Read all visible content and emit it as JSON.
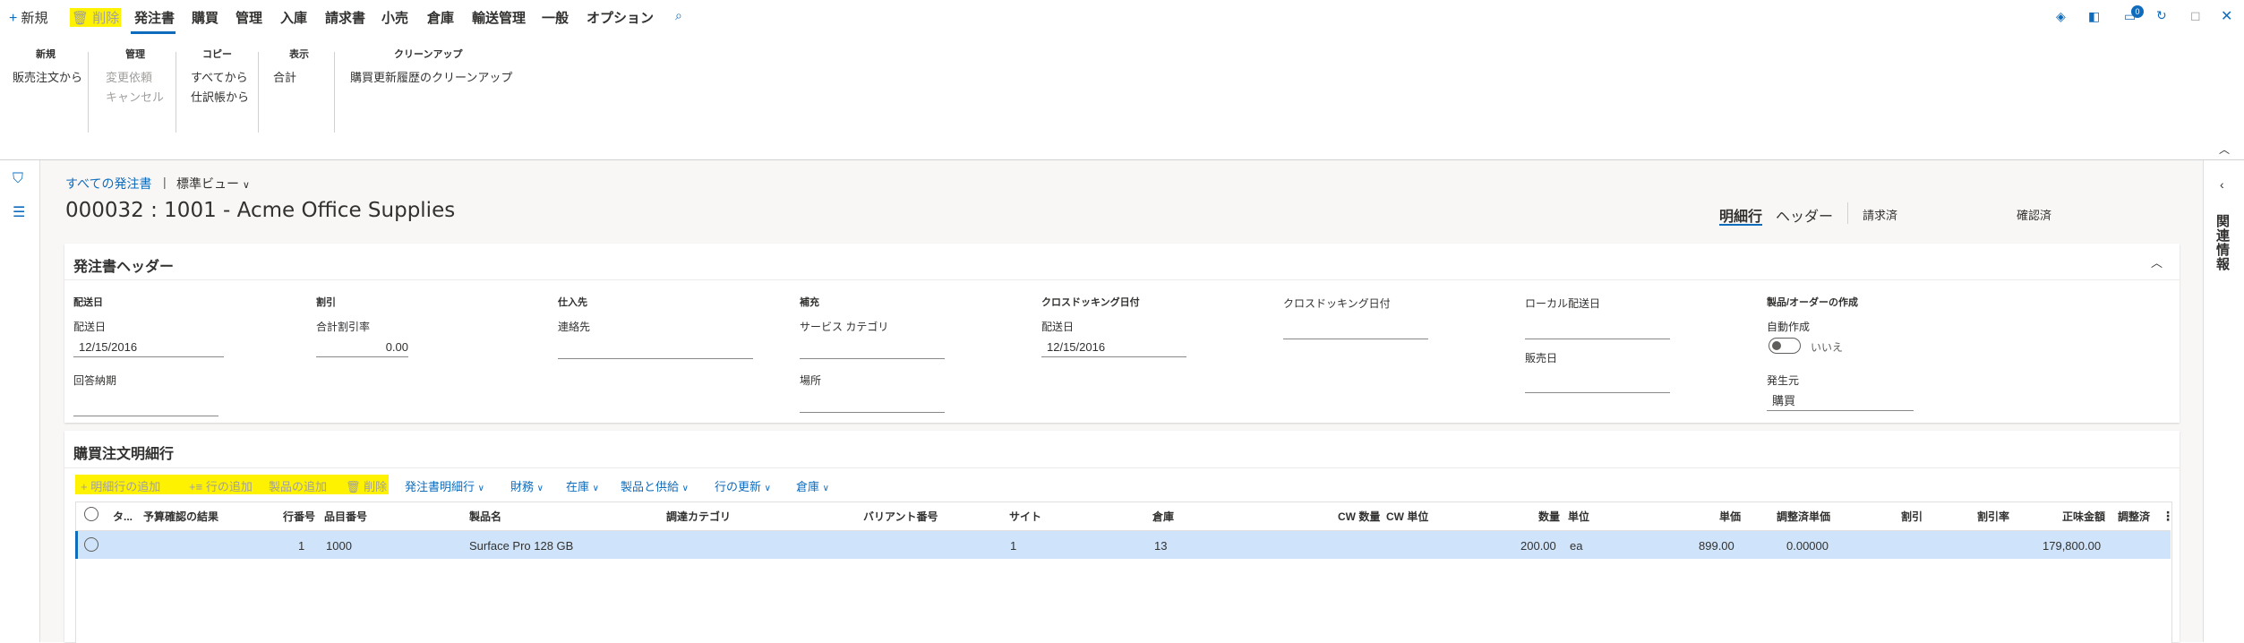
{
  "topbar": {
    "new": "新規",
    "delete": "削除",
    "tabs": [
      "発注書",
      "購買",
      "管理",
      "入庫",
      "請求書",
      "小売",
      "倉庫",
      "輸送管理",
      "一般",
      "オプション"
    ],
    "notification_count": "0"
  },
  "ribbon": {
    "groups": {
      "new": {
        "title": "新規",
        "items": [
          "販売注文から"
        ]
      },
      "manage": {
        "title": "管理",
        "items": [
          "変更依頼",
          "キャンセル"
        ]
      },
      "copy": {
        "title": "コピー",
        "items": [
          "すべてから",
          "仕訳帳から"
        ]
      },
      "view": {
        "title": "表示",
        "items": [
          "合計"
        ]
      },
      "cleanup": {
        "title": "クリーンアップ",
        "items": [
          "購買更新履歴のクリーンアップ"
        ]
      }
    }
  },
  "page": {
    "breadcrumb_link": "すべての発注書",
    "breadcrumb_sep": "|",
    "view_name": "標準ビュー",
    "title": "000032 : 1001 - Acme Office Supplies",
    "view_tabs": [
      "明細行",
      "ヘッダー"
    ],
    "status_invoice": "請求済",
    "status_confirm": "確認済",
    "related_info": "関連情報"
  },
  "header_card": {
    "title": "発注書ヘッダー",
    "sections": {
      "delivery": {
        "label": "配送日",
        "field_label": "配送日",
        "value": "12/15/2016",
        "reply_label": "回答納期"
      },
      "discount": {
        "label": "割引",
        "field_label": "合計割引率",
        "value": "0.00"
      },
      "vendor": {
        "label": "仕入先",
        "field_label": "連絡先"
      },
      "replenish": {
        "label": "補充",
        "field_label": "サービス カテゴリ",
        "site_label": "場所"
      },
      "crossdock": {
        "label": "クロスドッキング日付",
        "field_label": "配送日",
        "value": "12/15/2016"
      },
      "crossdock2": {
        "label": "クロスドッキング日付"
      },
      "local": {
        "label": "ローカル配送日",
        "sales_label": "販売日"
      },
      "product": {
        "label": "製品/オーダーの作成",
        "auto_label": "自動作成",
        "auto_value": "いいえ",
        "origin_label": "発生元",
        "origin_value": "購買"
      }
    }
  },
  "lines_card": {
    "title": "購買注文明細行",
    "toolbar": {
      "add_line": "明細行の追加",
      "add_lines": "行の追加",
      "add_products": "製品の追加",
      "delete": "削除",
      "menus": [
        "発注書明細行",
        "財務",
        "在庫",
        "製品と供給",
        "行の更新",
        "倉庫"
      ]
    },
    "columns": [
      "タ...",
      "予算確認の結果",
      "行番号",
      "品目番号",
      "製品名",
      "調達カテゴリ",
      "バリアント番号",
      "サイト",
      "倉庫",
      "CW 数量",
      "CW 単位",
      "数量",
      "単位",
      "単価",
      "調整済単価",
      "割引",
      "割引率",
      "正味金額",
      "調整済"
    ],
    "rows": [
      {
        "line": "1",
        "item": "1000",
        "product": "Surface Pro 128 GB",
        "site": "1",
        "warehouse": "13",
        "qty": "200.00",
        "unit": "ea",
        "price": "899.00",
        "adj_price": "0.00000",
        "net": "179,800.00"
      }
    ]
  },
  "colors": {
    "accent": "#0f6cbd",
    "highlight": "#fff200",
    "selected_row": "#cfe4fa"
  }
}
